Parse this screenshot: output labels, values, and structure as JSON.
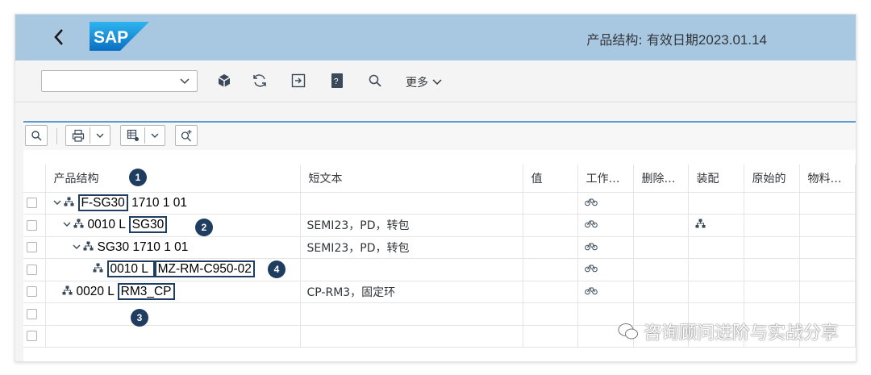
{
  "header": {
    "brand": "SAP",
    "title_prefix": "产品结构: 有效日期",
    "title_date": "2023.01.14"
  },
  "toolbar": {
    "combo_value": "",
    "more_label": "更多"
  },
  "table": {
    "columns": [
      "产品结构",
      "短文本",
      "值",
      "工作…",
      "删除…",
      "装配",
      "原始的",
      "物料…"
    ],
    "rows": [
      {
        "indent": 0,
        "chevron": true,
        "struct_a": "F-SG30",
        "struct_b": " 1710 1 01",
        "short": "",
        "work": true,
        "assembly": false
      },
      {
        "indent": 1,
        "chevron": true,
        "struct_a": "0010 L ",
        "struct_b": "SG30",
        "short": "SEMI23，PD，转包",
        "work": true,
        "assembly": true
      },
      {
        "indent": 2,
        "chevron": true,
        "struct_a": "SG30 1710 1 01",
        "struct_b": "",
        "short": "SEMI23，PD，转包",
        "work": true,
        "assembly": false
      },
      {
        "indent": 3,
        "chevron": false,
        "struct_a": "0010 L ",
        "struct_b": "MZ-RM-C950-02",
        "short": "",
        "work": true,
        "assembly": false
      },
      {
        "indent": 1,
        "chevron": false,
        "struct_a": "0020 L ",
        "struct_b": "RM3_CP",
        "short": "CP-RM3，固定环",
        "work": true,
        "assembly": false
      },
      {
        "indent": 0,
        "chevron": false,
        "struct_a": "",
        "struct_b": "",
        "short": "",
        "work": false,
        "assembly": false
      },
      {
        "indent": 0,
        "chevron": false,
        "struct_a": "",
        "struct_b": "",
        "short": "",
        "work": false,
        "assembly": false
      }
    ]
  },
  "badges": [
    "1",
    "2",
    "3",
    "4"
  ],
  "watermark": "咨询顾问进阶与实战分享",
  "colors": {
    "shell": "#a8c7e0",
    "badge": "#1f3d60",
    "accent": "#5a9bd5"
  }
}
